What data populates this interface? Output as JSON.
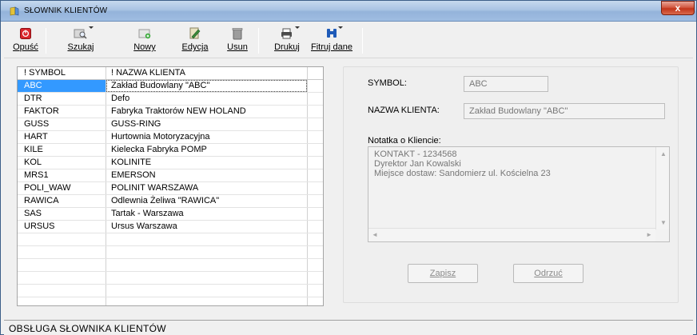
{
  "window": {
    "title": "SŁOWNIK KLIENTÓW",
    "close_label": "x"
  },
  "toolbar": {
    "opusc": "Opuść",
    "szukaj": "Szukaj",
    "nowy": "Nowy",
    "edycja": "Edycja",
    "usun": "Usun",
    "drukuj": "Drukuj",
    "filtruj": "Fitruj dane"
  },
  "grid": {
    "columns": [
      "! SYMBOL",
      "! NAZWA KLIENTA"
    ],
    "rows": [
      {
        "symbol": "ABC",
        "nazwa": "Zakład Budowlany \"ABC\""
      },
      {
        "symbol": "DTR",
        "nazwa": "Defo"
      },
      {
        "symbol": "FAKTOR",
        "nazwa": "Fabryka Traktorów NEW HOLAND"
      },
      {
        "symbol": "GUSS",
        "nazwa": "GUSS-RING"
      },
      {
        "symbol": "HART",
        "nazwa": "Hurtownia Motoryzacyjna"
      },
      {
        "symbol": "KILE",
        "nazwa": "Kielecka Fabryka POMP"
      },
      {
        "symbol": "KOL",
        "nazwa": "KOLINITE"
      },
      {
        "symbol": "MRS1",
        "nazwa": "EMERSON"
      },
      {
        "symbol": "POLI_WAW",
        "nazwa": "POLINIT WARSZAWA"
      },
      {
        "symbol": "RAWICA",
        "nazwa": "Odlewnia Żeliwa \"RAWICA\""
      },
      {
        "symbol": "SAS",
        "nazwa": "Tartak  - Warszawa"
      },
      {
        "symbol": "URSUS",
        "nazwa": "Ursus Warszawa"
      }
    ]
  },
  "detail": {
    "symbol_label": "SYMBOL:",
    "symbol_value": "ABC",
    "nazwa_label": "NAZWA KLIENTA:",
    "nazwa_value": "Zakład Budowlany \"ABC\"",
    "notatka_label": "Notatka o Kliencie:",
    "notatka_lines": [
      "KONTAKT - 1234568",
      "Dyrektor Jan Kowalski",
      "Miejsce dostaw: Sandomierz ul. Kościelna 23"
    ],
    "zapisz": "Zapisz",
    "odrzuc": "Odrzuć"
  },
  "status": {
    "text": "OBSŁUGA SŁOWNIKA KLIENTÓW"
  }
}
